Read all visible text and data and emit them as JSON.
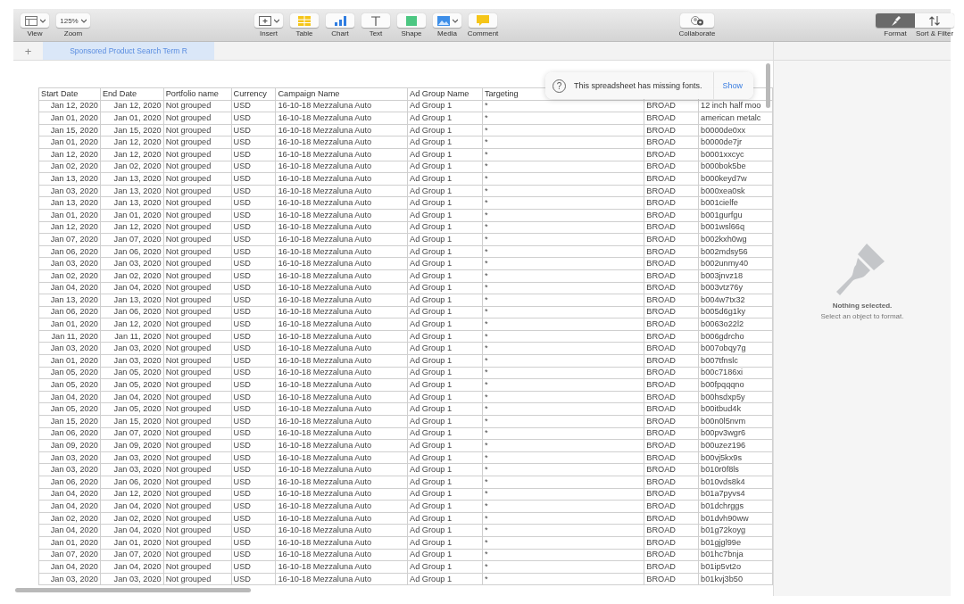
{
  "toolbar": {
    "left": [
      {
        "label": "View",
        "menu": true
      },
      {
        "label": "Zoom",
        "value": "125%",
        "menu": true
      }
    ],
    "center": [
      {
        "label": "Insert",
        "menu": true
      },
      {
        "label": "Table",
        "menu": false
      },
      {
        "label": "Chart",
        "menu": false
      },
      {
        "label": "Text",
        "menu": false
      },
      {
        "label": "Shape",
        "menu": false
      },
      {
        "label": "Media",
        "menu": true
      },
      {
        "label": "Comment",
        "menu": false
      }
    ],
    "collaborate": {
      "label": "Collaborate"
    },
    "right": [
      {
        "label": "Format",
        "selected": true
      },
      {
        "label": "Sort & Filter",
        "selected": false
      }
    ]
  },
  "sheet_tabs": {
    "add": "+",
    "tabs": [
      {
        "label": "Sponsored Product Search Term R",
        "selected": true
      }
    ]
  },
  "notice": {
    "icon": "?",
    "text": "This spreadsheet has missing fonts.",
    "action": "Show"
  },
  "table": {
    "columns": [
      "Start Date",
      "End Date",
      "Portfolio name",
      "Currency",
      "Campaign Name",
      "Ad Group Name",
      "Targeting"
    ],
    "rows": [
      [
        "Jan 12, 2020",
        "Jan 12, 2020",
        "Not grouped",
        "USD",
        "16-10-18 Mezzaluna Auto",
        "Ad Group 1",
        "*",
        "BROAD",
        "12 inch half moo"
      ],
      [
        "Jan 01, 2020",
        "Jan 01, 2020",
        "Not grouped",
        "USD",
        "16-10-18 Mezzaluna Auto",
        "Ad Group 1",
        "*",
        "BROAD",
        "american metalc"
      ],
      [
        "Jan 15, 2020",
        "Jan 15, 2020",
        "Not grouped",
        "USD",
        "16-10-18 Mezzaluna Auto",
        "Ad Group 1",
        "*",
        "BROAD",
        "b0000de0xx"
      ],
      [
        "Jan 01, 2020",
        "Jan 12, 2020",
        "Not grouped",
        "USD",
        "16-10-18 Mezzaluna Auto",
        "Ad Group 1",
        "*",
        "BROAD",
        "b0000de7jr"
      ],
      [
        "Jan 12, 2020",
        "Jan 12, 2020",
        "Not grouped",
        "USD",
        "16-10-18 Mezzaluna Auto",
        "Ad Group 1",
        "*",
        "BROAD",
        "b0001xxcyc"
      ],
      [
        "Jan 02, 2020",
        "Jan 02, 2020",
        "Not grouped",
        "USD",
        "16-10-18 Mezzaluna Auto",
        "Ad Group 1",
        "*",
        "BROAD",
        "b000bok5be"
      ],
      [
        "Jan 13, 2020",
        "Jan 13, 2020",
        "Not grouped",
        "USD",
        "16-10-18 Mezzaluna Auto",
        "Ad Group 1",
        "*",
        "BROAD",
        "b000keyd7w"
      ],
      [
        "Jan 03, 2020",
        "Jan 13, 2020",
        "Not grouped",
        "USD",
        "16-10-18 Mezzaluna Auto",
        "Ad Group 1",
        "*",
        "BROAD",
        "b000xea0sk"
      ],
      [
        "Jan 13, 2020",
        "Jan 13, 2020",
        "Not grouped",
        "USD",
        "16-10-18 Mezzaluna Auto",
        "Ad Group 1",
        "*",
        "BROAD",
        "b001cielfe"
      ],
      [
        "Jan 01, 2020",
        "Jan 01, 2020",
        "Not grouped",
        "USD",
        "16-10-18 Mezzaluna Auto",
        "Ad Group 1",
        "*",
        "BROAD",
        "b001gurfgu"
      ],
      [
        "Jan 12, 2020",
        "Jan 12, 2020",
        "Not grouped",
        "USD",
        "16-10-18 Mezzaluna Auto",
        "Ad Group 1",
        "*",
        "BROAD",
        "b001wsl66q"
      ],
      [
        "Jan 07, 2020",
        "Jan 07, 2020",
        "Not grouped",
        "USD",
        "16-10-18 Mezzaluna Auto",
        "Ad Group 1",
        "*",
        "BROAD",
        "b002kxh0wg"
      ],
      [
        "Jan 06, 2020",
        "Jan 06, 2020",
        "Not grouped",
        "USD",
        "16-10-18 Mezzaluna Auto",
        "Ad Group 1",
        "*",
        "BROAD",
        "b002mdsy56"
      ],
      [
        "Jan 03, 2020",
        "Jan 03, 2020",
        "Not grouped",
        "USD",
        "16-10-18 Mezzaluna Auto",
        "Ad Group 1",
        "*",
        "BROAD",
        "b002unmy40"
      ],
      [
        "Jan 02, 2020",
        "Jan 02, 2020",
        "Not grouped",
        "USD",
        "16-10-18 Mezzaluna Auto",
        "Ad Group 1",
        "*",
        "BROAD",
        "b003jnvz18"
      ],
      [
        "Jan 04, 2020",
        "Jan 04, 2020",
        "Not grouped",
        "USD",
        "16-10-18 Mezzaluna Auto",
        "Ad Group 1",
        "*",
        "BROAD",
        "b003vtz76y"
      ],
      [
        "Jan 13, 2020",
        "Jan 13, 2020",
        "Not grouped",
        "USD",
        "16-10-18 Mezzaluna Auto",
        "Ad Group 1",
        "*",
        "BROAD",
        "b004w7tx32"
      ],
      [
        "Jan 06, 2020",
        "Jan 06, 2020",
        "Not grouped",
        "USD",
        "16-10-18 Mezzaluna Auto",
        "Ad Group 1",
        "*",
        "BROAD",
        "b005d6g1ky"
      ],
      [
        "Jan 01, 2020",
        "Jan 12, 2020",
        "Not grouped",
        "USD",
        "16-10-18 Mezzaluna Auto",
        "Ad Group 1",
        "*",
        "BROAD",
        "b0063o22l2"
      ],
      [
        "Jan 11, 2020",
        "Jan 11, 2020",
        "Not grouped",
        "USD",
        "16-10-18 Mezzaluna Auto",
        "Ad Group 1",
        "*",
        "BROAD",
        "b006gdrcho"
      ],
      [
        "Jan 03, 2020",
        "Jan 03, 2020",
        "Not grouped",
        "USD",
        "16-10-18 Mezzaluna Auto",
        "Ad Group 1",
        "*",
        "BROAD",
        "b007obqy7g"
      ],
      [
        "Jan 01, 2020",
        "Jan 03, 2020",
        "Not grouped",
        "USD",
        "16-10-18 Mezzaluna Auto",
        "Ad Group 1",
        "*",
        "BROAD",
        "b007tfnslc"
      ],
      [
        "Jan 05, 2020",
        "Jan 05, 2020",
        "Not grouped",
        "USD",
        "16-10-18 Mezzaluna Auto",
        "Ad Group 1",
        "*",
        "BROAD",
        "b00c7186xi"
      ],
      [
        "Jan 05, 2020",
        "Jan 05, 2020",
        "Not grouped",
        "USD",
        "16-10-18 Mezzaluna Auto",
        "Ad Group 1",
        "*",
        "BROAD",
        "b00fpqqqno"
      ],
      [
        "Jan 04, 2020",
        "Jan 04, 2020",
        "Not grouped",
        "USD",
        "16-10-18 Mezzaluna Auto",
        "Ad Group 1",
        "*",
        "BROAD",
        "b00hsdxp5y"
      ],
      [
        "Jan 05, 2020",
        "Jan 05, 2020",
        "Not grouped",
        "USD",
        "16-10-18 Mezzaluna Auto",
        "Ad Group 1",
        "*",
        "BROAD",
        "b00itbud4k"
      ],
      [
        "Jan 15, 2020",
        "Jan 15, 2020",
        "Not grouped",
        "USD",
        "16-10-18 Mezzaluna Auto",
        "Ad Group 1",
        "*",
        "BROAD",
        "b00n0l5nvm"
      ],
      [
        "Jan 06, 2020",
        "Jan 07, 2020",
        "Not grouped",
        "USD",
        "16-10-18 Mezzaluna Auto",
        "Ad Group 1",
        "*",
        "BROAD",
        "b00pv3wgr6"
      ],
      [
        "Jan 09, 2020",
        "Jan 09, 2020",
        "Not grouped",
        "USD",
        "16-10-18 Mezzaluna Auto",
        "Ad Group 1",
        "*",
        "BROAD",
        "b00uzez196"
      ],
      [
        "Jan 03, 2020",
        "Jan 03, 2020",
        "Not grouped",
        "USD",
        "16-10-18 Mezzaluna Auto",
        "Ad Group 1",
        "*",
        "BROAD",
        "b00vj5kx9s"
      ],
      [
        "Jan 03, 2020",
        "Jan 03, 2020",
        "Not grouped",
        "USD",
        "16-10-18 Mezzaluna Auto",
        "Ad Group 1",
        "*",
        "BROAD",
        "b010r0f8ls"
      ],
      [
        "Jan 06, 2020",
        "Jan 06, 2020",
        "Not grouped",
        "USD",
        "16-10-18 Mezzaluna Auto",
        "Ad Group 1",
        "*",
        "BROAD",
        "b010vds8k4"
      ],
      [
        "Jan 04, 2020",
        "Jan 12, 2020",
        "Not grouped",
        "USD",
        "16-10-18 Mezzaluna Auto",
        "Ad Group 1",
        "*",
        "BROAD",
        "b01a7pyvs4"
      ],
      [
        "Jan 04, 2020",
        "Jan 04, 2020",
        "Not grouped",
        "USD",
        "16-10-18 Mezzaluna Auto",
        "Ad Group 1",
        "*",
        "BROAD",
        "b01dchrggs"
      ],
      [
        "Jan 02, 2020",
        "Jan 02, 2020",
        "Not grouped",
        "USD",
        "16-10-18 Mezzaluna Auto",
        "Ad Group 1",
        "*",
        "BROAD",
        "b01dvh90ww"
      ],
      [
        "Jan 04, 2020",
        "Jan 04, 2020",
        "Not grouped",
        "USD",
        "16-10-18 Mezzaluna Auto",
        "Ad Group 1",
        "*",
        "BROAD",
        "b01g72koyg"
      ],
      [
        "Jan 01, 2020",
        "Jan 01, 2020",
        "Not grouped",
        "USD",
        "16-10-18 Mezzaluna Auto",
        "Ad Group 1",
        "*",
        "BROAD",
        "b01gjgl99e"
      ],
      [
        "Jan 07, 2020",
        "Jan 07, 2020",
        "Not grouped",
        "USD",
        "16-10-18 Mezzaluna Auto",
        "Ad Group 1",
        "*",
        "BROAD",
        "b01hc7bnja"
      ],
      [
        "Jan 04, 2020",
        "Jan 04, 2020",
        "Not grouped",
        "USD",
        "16-10-18 Mezzaluna Auto",
        "Ad Group 1",
        "*",
        "BROAD",
        "b01ip5vt2o"
      ],
      [
        "Jan 03, 2020",
        "Jan 03, 2020",
        "Not grouped",
        "USD",
        "16-10-18 Mezzaluna Auto",
        "Ad Group 1",
        "*",
        "BROAD",
        "b01kvj3b50"
      ]
    ]
  },
  "inspector": {
    "title": "Nothing selected.",
    "hint": "Select an object to format."
  }
}
